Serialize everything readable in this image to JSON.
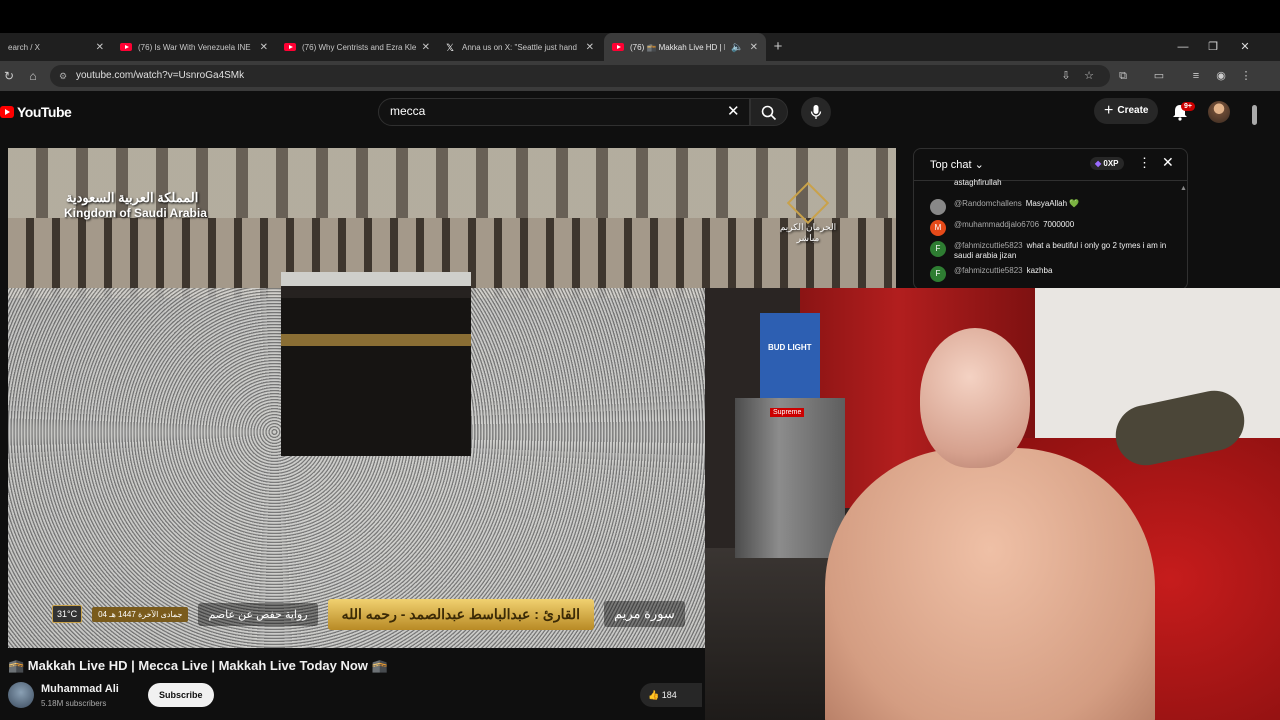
{
  "browser": {
    "tabs": [
      {
        "title": "earch / X",
        "icon": "x-logo-icon",
        "active": false
      },
      {
        "title": "(76) Is War With Venezuela INE",
        "icon": "youtube-icon",
        "active": false
      },
      {
        "title": "(76) Why Centrists and Ezra Kle",
        "icon": "youtube-icon",
        "active": false
      },
      {
        "title": "Anna us on X: \"Seattle just hand",
        "icon": "x-logo-icon",
        "active": false
      },
      {
        "title": "(76) 🕋 Makkah Live HD | M",
        "icon": "youtube-icon",
        "active": true
      }
    ],
    "url": "youtube.com/watch?v=UsnroGa4SMk"
  },
  "youtube": {
    "logo_text": "YouTube",
    "search_query": "mecca",
    "create_label": "Create",
    "notification_badge": "9+"
  },
  "video": {
    "overlay_country_ar": "المملكة العربية السعودية",
    "overlay_country_en": "Kingdom of Saudi Arabia",
    "overlay_channel_ar": "الحرمان الكريم",
    "overlay_live_ar": "مباشر",
    "temperature": "31°C",
    "hijri_date": "04 جمادى الآخرة 1447 هـ",
    "riwaya": "رواية حفص عن عاصم",
    "qari": "القارئ : عبدالباسط عبدالصمد - رحمه الله",
    "surah": "سورة مريم",
    "title": "🕋 Makkah Live HD | Mecca Live | Makkah Live Today Now 🕋",
    "channel_name": "Muhammad Ali",
    "subscribers": "5.18M subscribers",
    "subscribe_label": "Subscribe",
    "likes": "184"
  },
  "chat": {
    "header": "Top chat",
    "xp": "0XP",
    "messages": [
      {
        "author": "",
        "text": "astaghfirullah",
        "avatar_color": "#555555",
        "initial": ""
      },
      {
        "author": "@Randomchallens",
        "text": "MasyaAllah 💚",
        "avatar_color": "#888888",
        "initial": ""
      },
      {
        "author": "@muhammaddjalo6706",
        "text": "7000000",
        "avatar_color": "#e64a19",
        "initial": "M"
      },
      {
        "author": "@fahmizcuttie5823",
        "text": "what a beutiful i only go 2 tymes i am in saudi arabia jizan",
        "avatar_color": "#2e7d32",
        "initial": "F"
      },
      {
        "author": "@fahmizcuttie5823",
        "text": "kazhba",
        "avatar_color": "#2e7d32",
        "initial": "F"
      }
    ]
  },
  "webcam": {
    "box_label": "BUD LIGHT",
    "sticker": "Supreme"
  }
}
